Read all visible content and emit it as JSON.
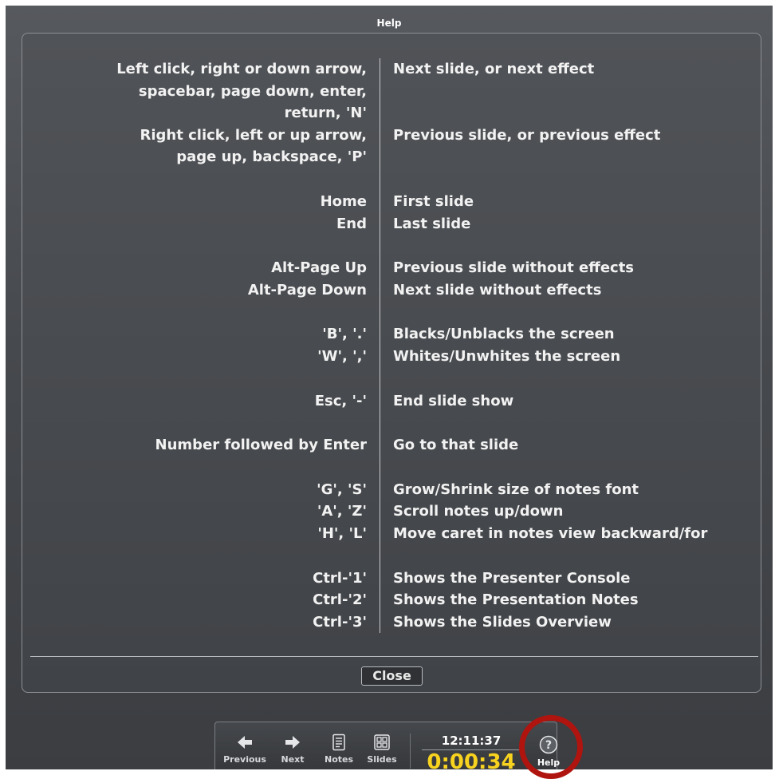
{
  "window": {
    "title": "Help"
  },
  "help": {
    "rows": [
      {
        "keys": "Left click,  right or down arrow,",
        "action": "Next slide,  or next effect"
      },
      {
        "keys": "spacebar,  page down,  enter,",
        "action": ""
      },
      {
        "keys": "return,  'N'",
        "action": ""
      },
      {
        "keys": "Right click,  left or up arrow,",
        "action": "Previous slide,  or previous effect"
      },
      {
        "keys": "page up,  backspace,  'P'",
        "action": ""
      },
      {
        "keys": "Home",
        "action": "First slide"
      },
      {
        "keys": "End",
        "action": "Last slide"
      },
      {
        "keys": "Alt-Page Up",
        "action": "Previous slide without effects"
      },
      {
        "keys": "Alt-Page Down",
        "action": "Next slide without effects"
      },
      {
        "keys": "'B',  '.'",
        "action": "Blacks/Unblacks the screen"
      },
      {
        "keys": "'W',  ','",
        "action": "Whites/Unwhites the screen"
      },
      {
        "keys": "Esc,  '-'",
        "action": "End slide show"
      },
      {
        "keys": "Number followed by Enter",
        "action": "Go to that slide"
      },
      {
        "keys": "'G',  'S'",
        "action": "Grow/Shrink size of notes font"
      },
      {
        "keys": "'A',  'Z'",
        "action": "Scroll notes up/down"
      },
      {
        "keys": "'H',  'L'",
        "action": "Move caret in notes view backward/for"
      },
      {
        "keys": "Ctrl-'1'",
        "action": "Shows the Presenter Console"
      },
      {
        "keys": "Ctrl-'2'",
        "action": "Shows the Presentation Notes"
      },
      {
        "keys": "Ctrl-'3'",
        "action": "Shows the Slides Overview"
      }
    ],
    "close_label": "Close"
  },
  "toolbar": {
    "previous_label": "Previous",
    "next_label": "Next",
    "notes_label": "Notes",
    "slides_label": "Slides",
    "help_label": "Help",
    "clock": "12:11:37",
    "timer": "0:00:34",
    "timer_color": "#f7d21f",
    "highlight_color": "#b0140f"
  }
}
